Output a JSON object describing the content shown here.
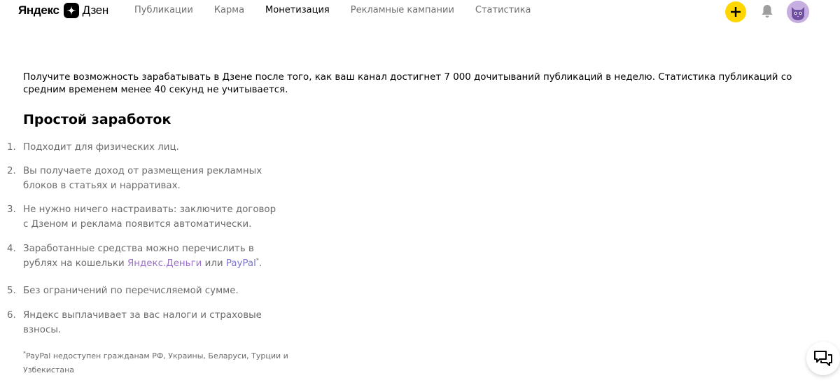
{
  "header": {
    "logo_yandex": "Яндекс",
    "logo_dzen": "Дзен",
    "nav": [
      {
        "label": "Публикации",
        "active": false
      },
      {
        "label": "Карма",
        "active": false
      },
      {
        "label": "Монетизация",
        "active": true
      },
      {
        "label": "Рекламные кампании",
        "active": false
      },
      {
        "label": "Статистика",
        "active": false
      }
    ],
    "actions": {
      "plus_icon": "plus-icon",
      "bell_icon": "bell-icon",
      "avatar_icon": "cat-avatar-icon"
    }
  },
  "main": {
    "intro": "Получите возможность зарабатывать в Дзене после того, как ваш канал достигнет 7 000 дочитываний публикаций в неделю. Статистика публикаций со средним временем менее 40 секунд не учитывается.",
    "section_title": "Простой заработок",
    "items": [
      {
        "num": "1.",
        "text": "Подходит для физических лиц."
      },
      {
        "num": "2.",
        "text": "Вы получаете доход от размещения рекламных блоков в статьях и нарративах."
      },
      {
        "num": "3.",
        "text": "Не нужно ничего настраивать: заключите договор с Дзеном и реклама появится автоматически."
      },
      {
        "num": "4.",
        "text_before": "Заработанные средства можно перечислить в рублях на кошельки ",
        "link1": "Яндекс.Деньги",
        "text_mid": " или ",
        "link2": "PayPal",
        "sup": "*",
        "text_after": "."
      },
      {
        "num": "5.",
        "text": "Без ограничений по перечисляемой сумме."
      },
      {
        "num": "6.",
        "text": "Яндекс выплачивает за вас налоги и страховые взносы."
      }
    ],
    "footnote_mark": "*",
    "footnote": "PayPal недоступен гражданам РФ, Украины, Беларуси, Турции и Узбекистана"
  },
  "chat": {
    "icon": "chat-bubbles-icon"
  },
  "colors": {
    "accent_yellow": "#ffd600",
    "link_purple": "#9a72c9",
    "link_paypal": "#7b74d1",
    "muted_text": "#6b6b6b"
  }
}
